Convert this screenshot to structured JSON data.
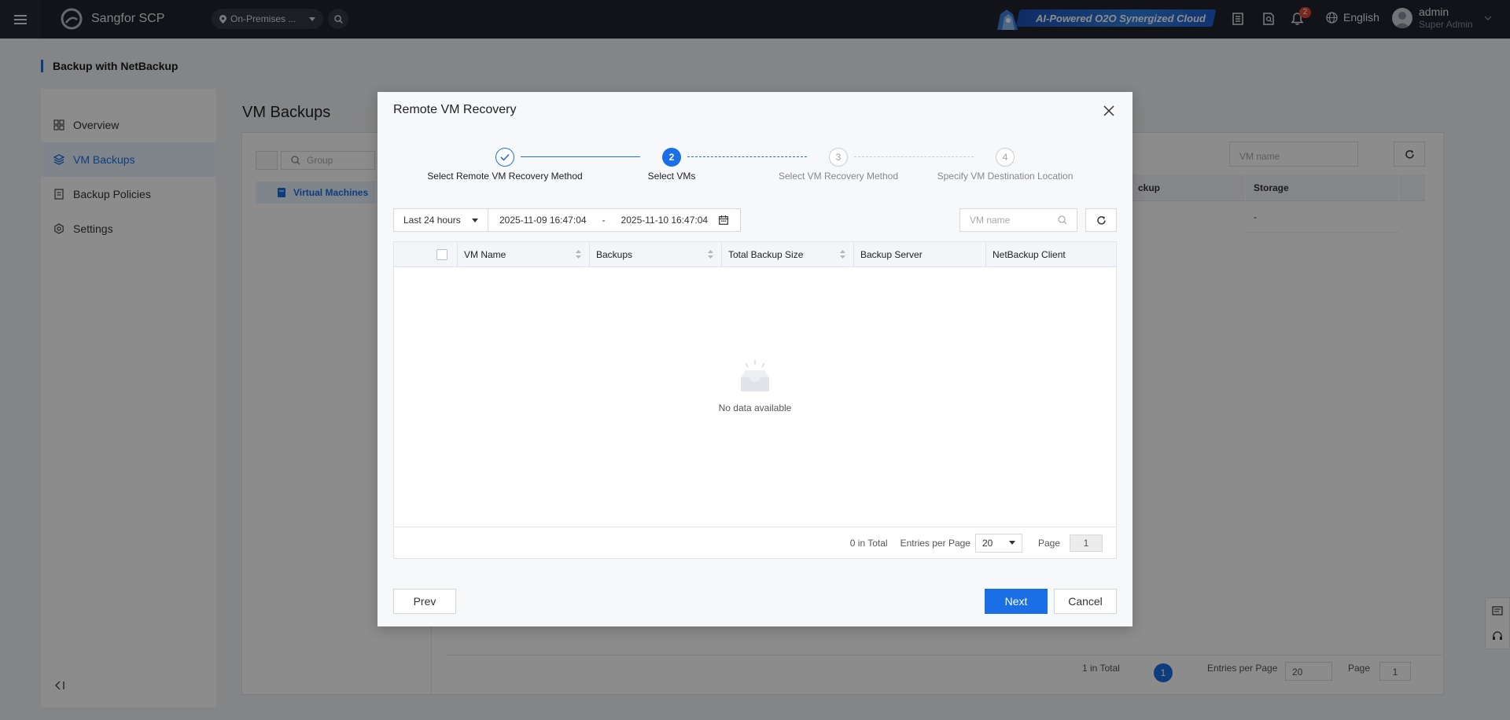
{
  "topbar": {
    "brand": "Sangfor SCP",
    "location": "On-Premises ...",
    "ai_banner": "AI-Powered O2O Synergized Cloud",
    "notification_count": "2",
    "language": "English",
    "user_name": "admin",
    "user_role": "Super Admin"
  },
  "page": {
    "title": "Backup with NetBackup",
    "nav": [
      {
        "label": "Overview",
        "icon": "dashboard-icon"
      },
      {
        "label": "VM Backups",
        "icon": "layers-icon"
      },
      {
        "label": "Backup Policies",
        "icon": "policy-icon"
      },
      {
        "label": "Settings",
        "icon": "settings-icon"
      }
    ],
    "section_title": "VM Backups",
    "group_placeholder": "Group",
    "tree_item": "Virtual Machines",
    "vm_name_placeholder": "VM name",
    "table_headers": [
      "ckup",
      "Storage"
    ],
    "table_row": "-",
    "footer": {
      "total": "1 in Total",
      "current_page": "1",
      "entries_label": "Entries per Page",
      "entries_value": "20",
      "page_label": "Page",
      "page_value": "1"
    }
  },
  "modal": {
    "title": "Remote VM Recovery",
    "steps": [
      {
        "number": "1",
        "label": "Select Remote VM Recovery Method",
        "state": "done"
      },
      {
        "number": "2",
        "label": "Select VMs",
        "state": "active"
      },
      {
        "number": "3",
        "label": "Select VM Recovery Method",
        "state": "pending"
      },
      {
        "number": "4",
        "label": "Specify VM Destination Location",
        "state": "pending"
      }
    ],
    "range": "Last 24 hours",
    "start": "2025-11-09 16:47:04",
    "separator": "-",
    "end": "2025-11-10 16:47:04",
    "search_placeholder": "VM name",
    "columns": [
      "VM Name",
      "Backups",
      "Total Backup Size",
      "Backup Server",
      "NetBackup Client"
    ],
    "empty_text": "No data available",
    "footer": {
      "total": "0 in Total",
      "entries_label": "Entries per Page",
      "entries_value": "20",
      "page_label": "Page",
      "page_value": "1"
    },
    "prev_label": "Prev",
    "next_label": "Next",
    "cancel_label": "Cancel"
  },
  "colors": {
    "accent": "#1a6fe6",
    "topbar": "#1f232c",
    "badge": "#e0483c"
  }
}
